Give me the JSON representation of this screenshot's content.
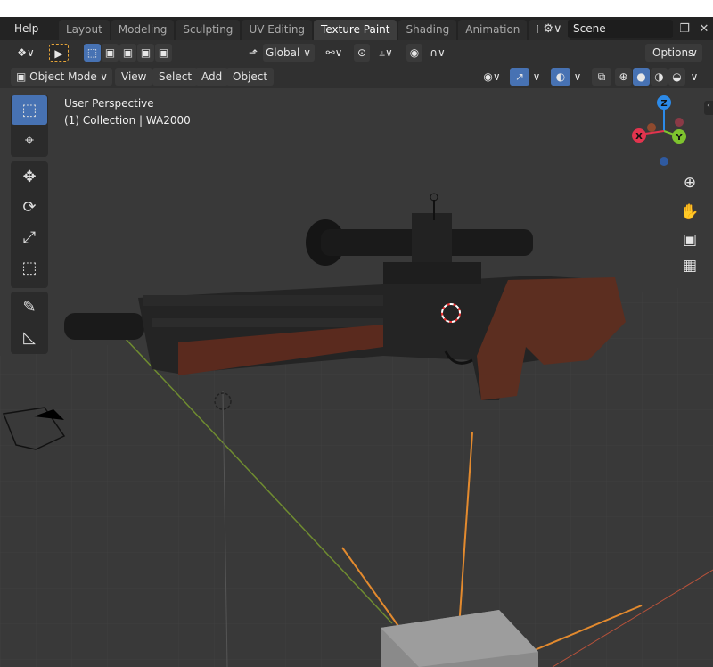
{
  "header": {
    "help_menu": "Help",
    "tabs": [
      {
        "label": "Layout"
      },
      {
        "label": "Modeling"
      },
      {
        "label": "Sculpting"
      },
      {
        "label": "UV Editing"
      },
      {
        "label": "Texture Paint"
      },
      {
        "label": "Shading"
      },
      {
        "label": "Animation"
      },
      {
        "label": "Rend"
      }
    ],
    "active_tab": "Texture Paint",
    "scene_name": "Scene"
  },
  "toolbar": {
    "transform_orientation": "Global",
    "options_label": "Options"
  },
  "viewport_header": {
    "mode": "Object Mode",
    "menus": [
      "View",
      "Select",
      "Add",
      "Object"
    ]
  },
  "overlay": {
    "perspective": "User Perspective",
    "collection": "(1) Collection | WA2000"
  },
  "gizmo": {
    "z_label": "Z",
    "y_label": "Y",
    "x_label": "X",
    "colors": {
      "x": "#e2344e",
      "y": "#7ec32e",
      "z": "#2c8ae8"
    }
  },
  "icons": {
    "tools": [
      "select-box-icon",
      "cursor-icon",
      "move-icon",
      "rotate-icon",
      "scale-icon",
      "transform-icon",
      "annotate-icon",
      "measure-icon"
    ],
    "nav": [
      "zoom-icon",
      "pan-hand-icon",
      "camera-view-icon",
      "ortho-grid-icon"
    ]
  }
}
